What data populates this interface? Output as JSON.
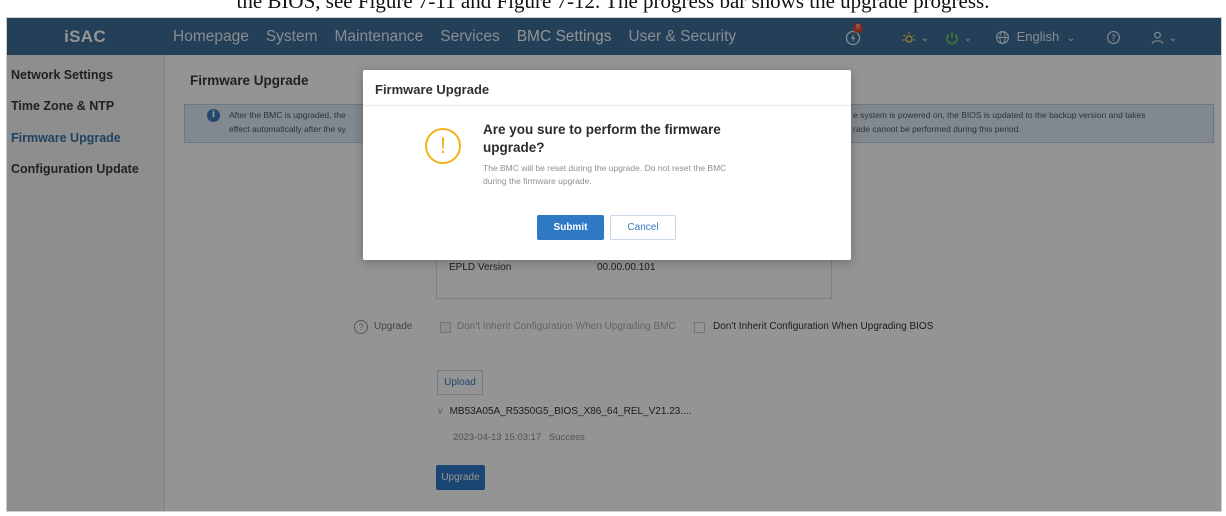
{
  "doc_caption": "the BIOS, see Figure 7-11 and Figure 7-12. The progress bar shows the upgrade progress.",
  "app": {
    "logo": "iSAC"
  },
  "nav": {
    "items": [
      {
        "label": "Homepage"
      },
      {
        "label": "System"
      },
      {
        "label": "Maintenance"
      },
      {
        "label": "Services"
      },
      {
        "label": "BMC Settings",
        "active": true
      },
      {
        "label": "User & Security"
      }
    ]
  },
  "toolbar": {
    "alarm_count": "9",
    "language": "English",
    "icons": [
      "alarm-icon",
      "indicator-light-icon",
      "power-icon",
      "globe-icon",
      "help-icon",
      "user-icon"
    ]
  },
  "sidebar": {
    "items": [
      {
        "label": "Network Settings"
      },
      {
        "label": "Time Zone & NTP"
      },
      {
        "label": "Firmware Upgrade",
        "active": true
      },
      {
        "label": "Configuration Update"
      }
    ]
  },
  "main": {
    "title": "Firmware Upgrade",
    "info": {
      "left_line1": "After the BMC is upgraded, the",
      "left_line2": "effect automatically after the sy",
      "right_line1": "e system is powered on, the BIOS is updated to the backup version and takes",
      "right_line2": "rade cannot be performed during this period."
    },
    "versions": [
      {
        "label": "EPLD Version",
        "value": "00.00.00.101"
      }
    ],
    "upgrade": {
      "label": "Upgrade",
      "option_bmc": "Don't Inherit Configuration When Upgrading BMC",
      "option_bios": "Don't Inherit Configuration When Upgrading BIOS"
    },
    "upload_label": "Upload",
    "file": {
      "name": "MB53A05A_R5350G5_BIOS_X86_64_REL_V21.23....",
      "timestamp": "2023-04-13 15:03:17",
      "status": "Success"
    },
    "upgrade_button": "Upgrade"
  },
  "dialog": {
    "title": "Firmware Upgrade",
    "heading_line1": "Are you sure to perform the firmware",
    "heading_line2": "upgrade?",
    "body_line1": "The BMC will be reset during the upgrade. Do not reset the BMC",
    "body_line2": "during the firmware upgrade.",
    "submit": "Submit",
    "cancel": "Cancel"
  },
  "colors": {
    "topbar": "#3d6f98",
    "accent": "#2f78c4",
    "warning": "#f2b21b",
    "banner": "#dfeaf5"
  }
}
